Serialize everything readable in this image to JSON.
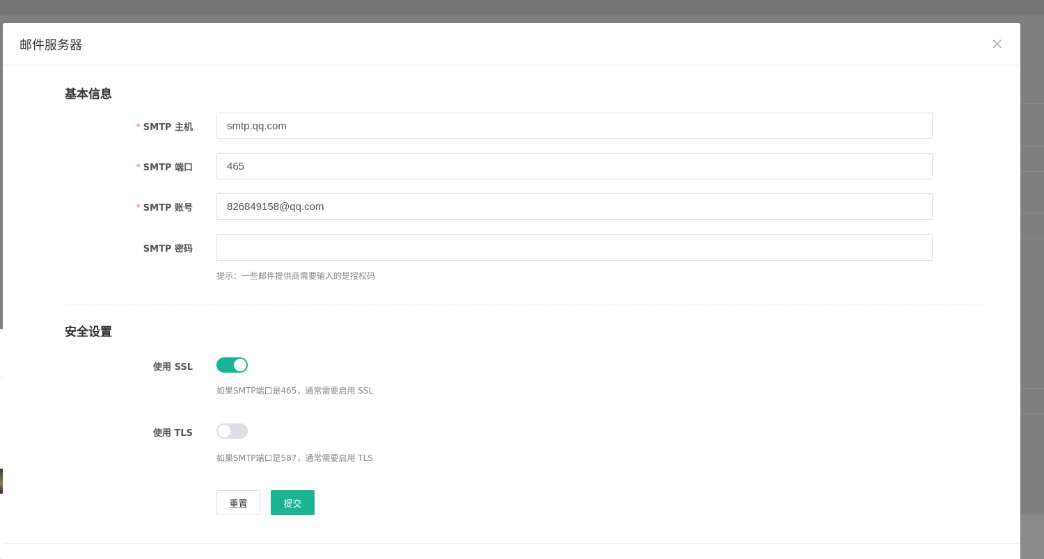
{
  "dialog": {
    "title": "邮件服务器",
    "close_symbol": "×"
  },
  "basic_section": {
    "title": "基本信息",
    "fields": [
      {
        "label": "SMTP 主机",
        "required": true,
        "value": "smtp.qq.com",
        "placeholder": ""
      },
      {
        "label": "SMTP 端口",
        "required": true,
        "value": "465",
        "placeholder": ""
      },
      {
        "label": "SMTP 账号",
        "required": true,
        "value": "826849158@qq.com",
        "placeholder": ""
      },
      {
        "label": "SMTP 密码",
        "required": false,
        "value": "",
        "placeholder": ""
      }
    ],
    "password_hint": "提示：一些邮件提供商需要输入的是授权码",
    "required_mark": "*"
  },
  "security_section": {
    "title": "安全设置",
    "ssl": {
      "label": "使用 SSL",
      "enabled": true,
      "hint": "如果SMTP端口是465，通常需要启用 SSL"
    },
    "tls": {
      "label": "使用 TLS",
      "enabled": false,
      "hint": "如果SMTP端口是587，通常需要启用 TLS"
    }
  },
  "actions": {
    "reset_label": "重置",
    "submit_label": "提交"
  },
  "side_panel": {
    "close_symbol": "×",
    "more_symbol": "···"
  },
  "colors": {
    "accent": "#1ab394",
    "required": "#f56c6c",
    "overlay": "#7f7f7f"
  }
}
